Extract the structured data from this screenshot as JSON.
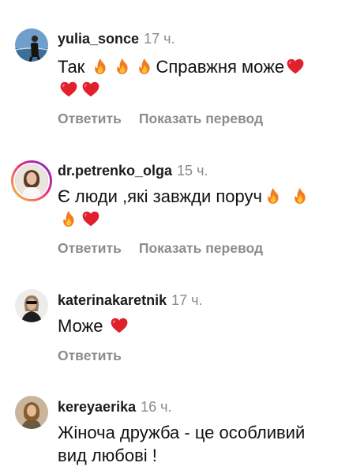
{
  "comments": [
    {
      "username": "yulia_sonce",
      "time": "17 ч.",
      "text_before": "Так",
      "text_after": "Справжня може",
      "reply": "Ответить",
      "translate": "Показать перевод",
      "emoji": [
        "fire-icon",
        "fire-icon",
        "fire-icon",
        "heart-icon",
        "heart-icon",
        "heart-icon"
      ]
    },
    {
      "username": "dr.petrenko_olga",
      "time": "15 ч.",
      "text_before": "Є люди ,які завжди поруч",
      "reply": "Ответить",
      "translate": "Показать перевод",
      "emoji": [
        "fire-icon",
        "fire-icon",
        "fire-icon",
        "heart-icon"
      ]
    },
    {
      "username": "katerinakaretnik",
      "time": "17 ч.",
      "text_before": "Може",
      "reply": "Ответить",
      "emoji": [
        "heart-icon"
      ]
    },
    {
      "username": "kereyaerika",
      "time": "16 ч.",
      "text_line1": "Жіноча дружба - це особливий",
      "text_line2": "вид любові !"
    }
  ],
  "colors": {
    "username": "#1b1b1b",
    "time": "#8a8a8a",
    "action": "#8c8c8c",
    "heart": "#e0202d",
    "fire": "#f47b20",
    "story_ring_start": "#f9ce34",
    "story_ring_end": "#6228d7"
  }
}
